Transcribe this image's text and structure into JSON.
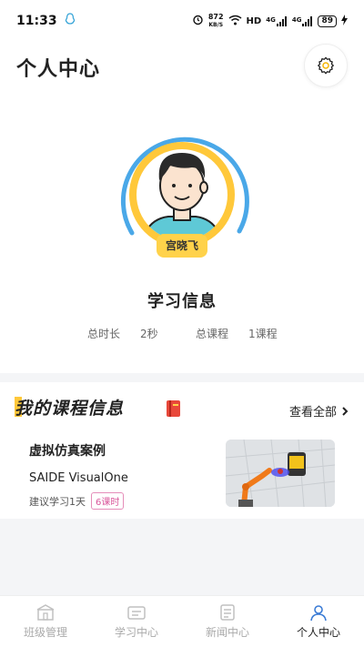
{
  "status_bar": {
    "time": "11:33",
    "net_speed_value": "872",
    "net_speed_unit": "KB/S",
    "hd_label": "HD",
    "signal_1": "4G",
    "signal_2": "4G",
    "battery": "89"
  },
  "header": {
    "title": "个人中心"
  },
  "profile": {
    "name": "宫晓飞",
    "section_title": "学习信息",
    "stats": {
      "total_time_label": "总时长",
      "total_time_value": "2秒",
      "total_courses_label": "总课程",
      "total_courses_value": "1课程"
    }
  },
  "courses_card": {
    "title": "我的课程信息",
    "view_all_label": "查看全部",
    "course": {
      "name": "虚拟仿真案例",
      "subtitle": "SAIDE VisualOne",
      "suggestion": "建议学习1天",
      "lessons": "6课时"
    }
  },
  "tab_bar": {
    "tabs": [
      {
        "label": "班级管理",
        "icon": "class-icon",
        "active": false
      },
      {
        "label": "学习中心",
        "icon": "study-icon",
        "active": false
      },
      {
        "label": "新闻中心",
        "icon": "news-icon",
        "active": false
      },
      {
        "label": "个人中心",
        "icon": "person-icon",
        "active": true
      }
    ]
  },
  "colors": {
    "accent_yellow": "#ffc83a",
    "ring_blue": "#4aa8e8",
    "badge_pink": "#d9559a"
  }
}
